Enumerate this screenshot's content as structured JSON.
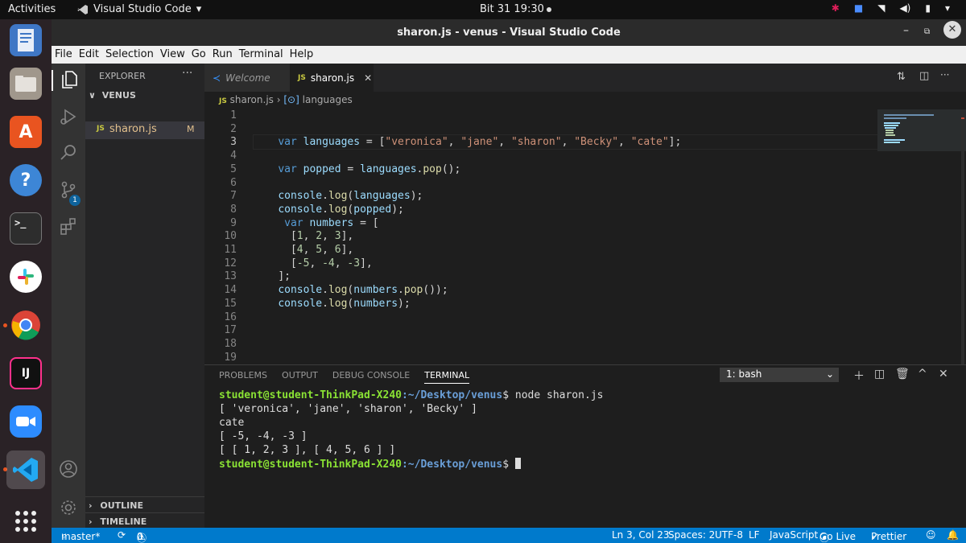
{
  "topbar": {
    "activities": "Activities",
    "app_name": "Visual Studio Code",
    "clock": "Bit 31  19:30"
  },
  "window": {
    "title": "sharon.js - venus - Visual Studio Code"
  },
  "menubar": [
    "File",
    "Edit",
    "Selection",
    "View",
    "Go",
    "Run",
    "Terminal",
    "Help"
  ],
  "activitybar": {
    "scm_badge": "1"
  },
  "sidebar": {
    "title": "EXPLORER",
    "folder": "VENUS",
    "file_name": "sharon.js",
    "file_status": "M",
    "outline": "OUTLINE",
    "timeline": "TIMELINE"
  },
  "tabs": [
    {
      "label": "Welcome"
    },
    {
      "label": "sharon.js"
    }
  ],
  "breadcrumb": {
    "file": "sharon.js",
    "symbol": "languages"
  },
  "editor": {
    "current_line": 3,
    "lines": [
      "",
      "",
      "    var languages = [\"veronica\", \"jane\", \"sharon\", \"Becky\", \"cate\"];",
      "",
      "    var popped = languages.pop();",
      "",
      "    console.log(languages);",
      "    console.log(popped);",
      "     var numbers = [",
      "      [1, 2, 3],",
      "      [4, 5, 6],",
      "      [-5, -4, -3],",
      "    ];",
      "    console.log(numbers.pop());",
      "    console.log(numbers);",
      "",
      "",
      "",
      ""
    ]
  },
  "panel": {
    "tabs": [
      "PROBLEMS",
      "OUTPUT",
      "DEBUG CONSOLE",
      "TERMINAL"
    ],
    "terminal_select": "1: bash",
    "prompt_user": "student@student-ThinkPad-X240",
    "prompt_path": ":~/Desktop/venus",
    "command": "$ node sharon.js",
    "output": [
      "[ 'veronica', 'jane', 'sharon', 'Becky' ]",
      "cate",
      "[ -5, -4, -3 ]",
      "[ [ 1, 2, 3 ], [ 4, 5, 6 ] ]"
    ],
    "prompt_end": "$"
  },
  "statusbar": {
    "branch": "master*",
    "problems": "0",
    "warnings": "0",
    "position": "Ln 3, Col 23",
    "spaces": "Spaces: 2",
    "encoding": "UTF-8",
    "eol": "LF",
    "language": "JavaScript",
    "golive": "Go Live",
    "prettier": "Prettier"
  },
  "colors": {
    "statusbar": "#007acc",
    "keyword": "#569cd6",
    "string": "#ce9178",
    "variable": "#9cdcfe",
    "function": "#dcdcaa",
    "number": "#b5cea8"
  }
}
